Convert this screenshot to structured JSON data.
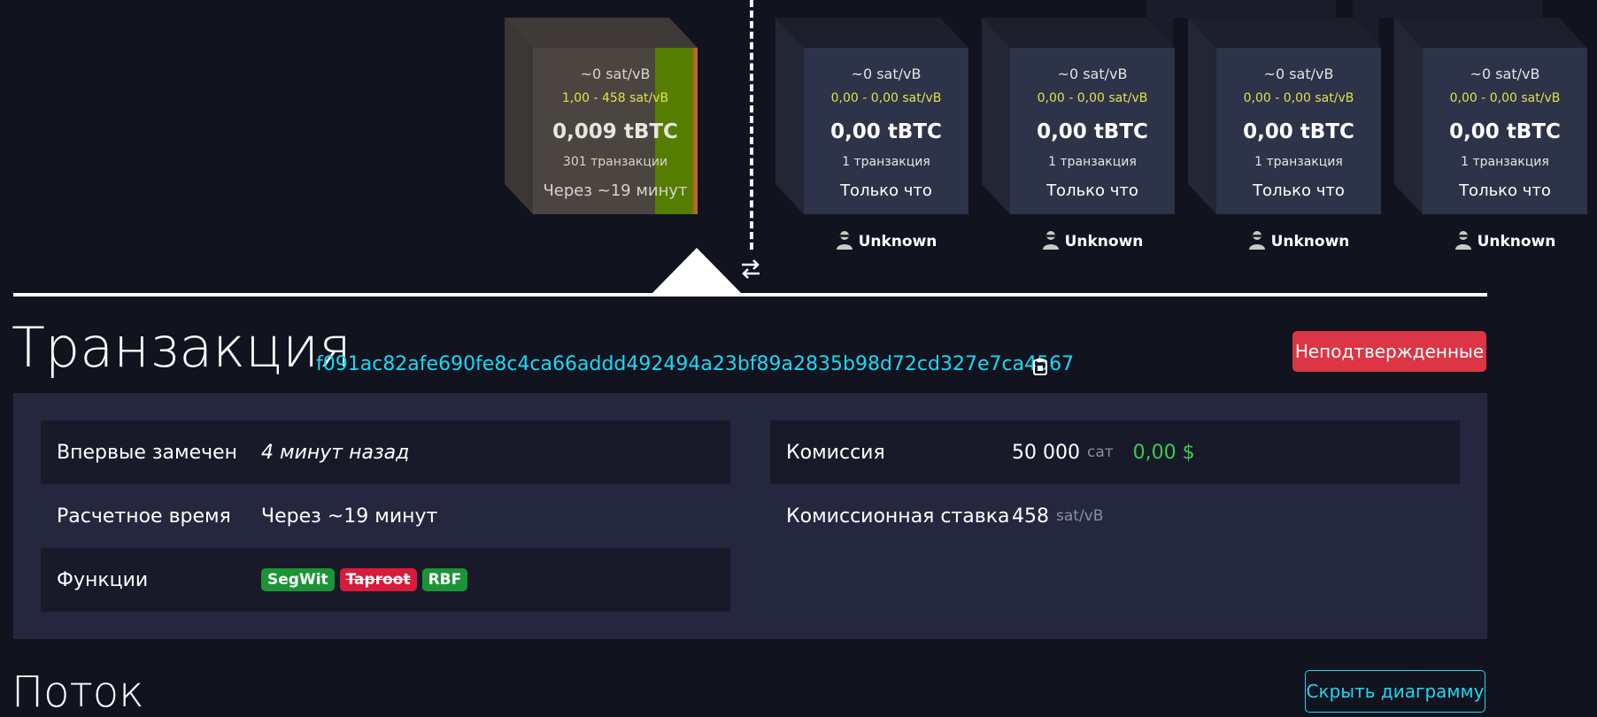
{
  "mempool_block": {
    "median_fee": "~0 sat/vB",
    "fee_range": "1,00 - 458 sat/vB",
    "total": "0,009 tBTC",
    "tx_count": "301 транзакции",
    "eta": "Через ~19 минут"
  },
  "blocks": [
    {
      "median_fee": "~0 sat/vB",
      "fee_range": "0,00 - 0,00 sat/vB",
      "total": "0,00 tBTC",
      "tx_count": "1 транзакция",
      "time": "Только что",
      "miner": "Unknown"
    },
    {
      "median_fee": "~0 sat/vB",
      "fee_range": "0,00 - 0,00 sat/vB",
      "total": "0,00 tBTC",
      "tx_count": "1 транзакция",
      "time": "Только что",
      "miner": "Unknown"
    },
    {
      "median_fee": "~0 sat/vB",
      "fee_range": "0,00 - 0,00 sat/vB",
      "total": "0,00 tBTC",
      "tx_count": "1 транзакция",
      "time": "Только что",
      "miner": "Unknown"
    },
    {
      "median_fee": "~0 sat/vB",
      "fee_range": "0,00 - 0,00 sat/vB",
      "total": "0,00 tBTC",
      "tx_count": "1 транзакция",
      "time": "Только что",
      "miner": "Unknown"
    }
  ],
  "transaction": {
    "title": "Транзакция",
    "txid": "f091ac82afe690fe8c4ca66addd492494a23bf89a2835b98d72cd327e7ca4567",
    "status_badge": "Неподтвержденные"
  },
  "details": {
    "first_seen": {
      "label": "Впервые замечен",
      "value": "4 минут назад"
    },
    "eta": {
      "label": "Расчетное время",
      "value": "Через ~19 минут"
    },
    "features": {
      "label": "Функции",
      "tags": [
        "SegWit",
        "Taproot",
        "RBF"
      ]
    },
    "fee": {
      "label": "Комиссия",
      "value": "50 000",
      "unit": "сат",
      "usd": "0,00 $"
    },
    "fee_rate": {
      "label": "Комиссионная ставка",
      "value": "458",
      "unit": "sat/vB"
    }
  },
  "flow": {
    "title": "Поток",
    "hide_button": "Скрыть диаграмму"
  },
  "colors": {
    "background": "#11131f",
    "accent": "#1bd8f4",
    "danger": "#dc3545",
    "success": "#1a9436",
    "fee_range_text": "#e0e24a"
  }
}
